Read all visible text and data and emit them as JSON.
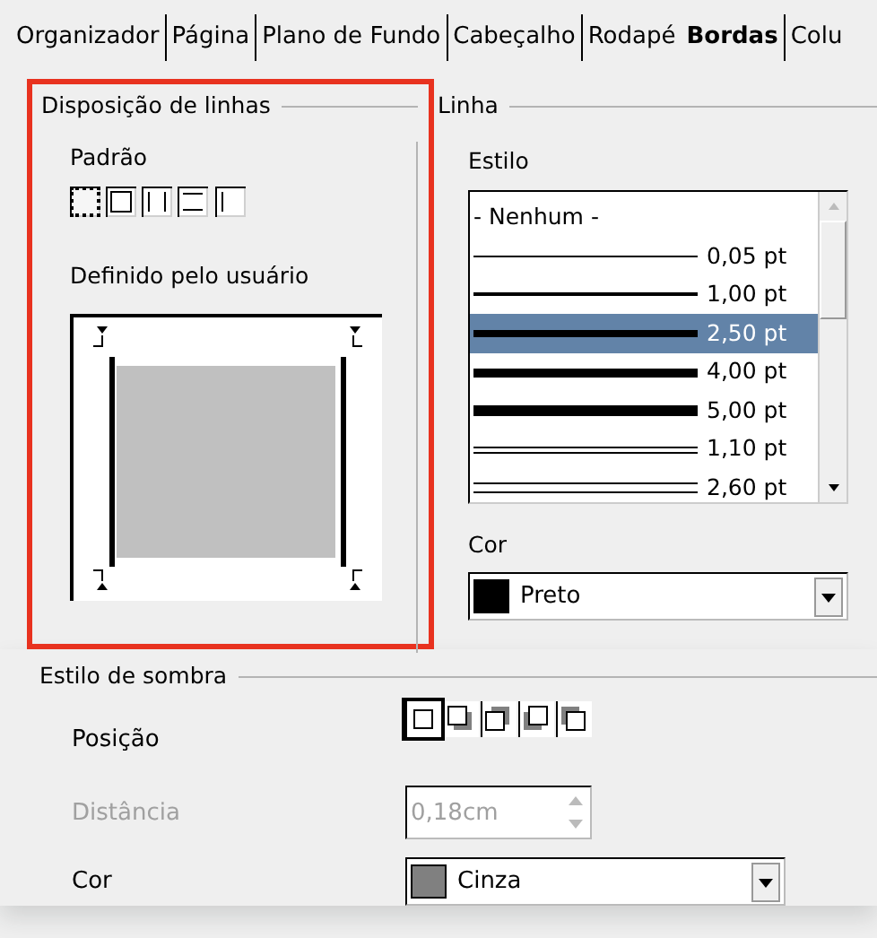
{
  "tabs": [
    {
      "label": "Organizador",
      "selected": false
    },
    {
      "label": "Página",
      "selected": false
    },
    {
      "label": "Plano de Fundo",
      "selected": false
    },
    {
      "label": "Cabeçalho",
      "selected": false
    },
    {
      "label": "Rodapé",
      "selected": false
    },
    {
      "label": "Bordas",
      "selected": true
    },
    {
      "label": "Colu",
      "selected": false
    }
  ],
  "line_arrangement": {
    "title": "Disposição de linhas",
    "default_label": "Padrão",
    "presets": [
      {
        "kind": "none",
        "selected": true
      },
      {
        "kind": "box",
        "selected": false
      },
      {
        "kind": "left-right",
        "selected": false
      },
      {
        "kind": "top-bottom",
        "selected": false
      },
      {
        "kind": "left",
        "selected": false
      }
    ],
    "user_defined_label": "Definido pelo usuário"
  },
  "line": {
    "title": "Linha",
    "style_label": "Estilo",
    "styles": [
      {
        "label": "- Nenhum -",
        "kind": "none",
        "selected": false
      },
      {
        "label": "0,05 pt",
        "kind": "hairline",
        "selected": false
      },
      {
        "label": "1,00 pt",
        "kind": "thin",
        "selected": false
      },
      {
        "label": "2,50 pt",
        "kind": "medium",
        "selected": true
      },
      {
        "label": "4,00 pt",
        "kind": "thick",
        "selected": false
      },
      {
        "label": "5,00 pt",
        "kind": "heavy",
        "selected": false
      },
      {
        "label": "1,10 pt",
        "kind": "double",
        "selected": false
      },
      {
        "label": "2,60 pt",
        "kind": "double-wide",
        "selected": false
      }
    ],
    "color_label": "Cor",
    "color": {
      "value": "Preto",
      "color": "#000000"
    }
  },
  "shadow": {
    "title": "Estilo de sombra",
    "position_label": "Posição",
    "positions": [
      {
        "kind": "none",
        "selected": true
      },
      {
        "kind": "bottom-right",
        "selected": false
      },
      {
        "kind": "top-right",
        "selected": false
      },
      {
        "kind": "bottom-left",
        "selected": false
      },
      {
        "kind": "top-left",
        "selected": false
      }
    ],
    "distance_label": "Distância",
    "distance_disabled": true,
    "distance_value": "0,18cm",
    "color_label": "Cor",
    "color": {
      "value": "Cinza",
      "color": "#808080"
    }
  }
}
